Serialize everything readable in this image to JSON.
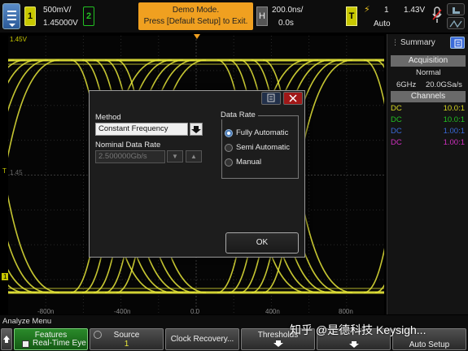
{
  "top": {
    "menu_icon": "hamburger-menu-icon",
    "ch1_label": "1",
    "ch1_scale": "500mV/",
    "ch1_offset": "1.45000V",
    "ch2_label": "2",
    "demo_line1": "Demo Mode.",
    "demo_line2": "Press [Default Setup] to Exit.",
    "h_label": "H",
    "timebase": "200.0ns/",
    "delay": "0.0s",
    "t_label": "T",
    "trigger_symbol": "⚡",
    "trigger_ch": "1",
    "trigger_level": "1.43V",
    "trigger_mode": "Auto"
  },
  "plot": {
    "level_top": "1.45V",
    "level_mid": "1.45",
    "trigger_marker": "T",
    "ground_marker": "1",
    "xticks": [
      "-800n",
      "-400n",
      "0.0",
      "400n",
      "800n"
    ],
    "trace_color": "#e8e83a"
  },
  "panel": {
    "tab": "Summary",
    "acquisition_title": "Acquisition",
    "acq_mode": "Normal",
    "bandwidth": "6GHz",
    "sample_rate": "20.0GSa/s",
    "channels_title": "Channels",
    "channels": [
      {
        "coupling": "DC",
        "ratio": "10.0:1",
        "color": "#d8d820"
      },
      {
        "coupling": "DC",
        "ratio": "10.0:1",
        "color": "#22c022"
      },
      {
        "coupling": "DC",
        "ratio": "1.00:1",
        "color": "#3a6ad8"
      },
      {
        "coupling": "DC",
        "ratio": "1.00:1",
        "color": "#d030c0"
      }
    ]
  },
  "dialog": {
    "method_label": "Method",
    "method_value": "Constant Frequency",
    "nominal_label": "Nominal Data Rate",
    "nominal_value": "2.500000Gb/s",
    "data_rate_title": "Data Rate",
    "options": [
      "Fully Automatic",
      "Semi Automatic",
      "Manual"
    ],
    "selected": 0,
    "ok_label": "OK"
  },
  "bottom": {
    "menu_title": "Analyze Menu",
    "features_label": "Features",
    "realtime_eye_label": "Real-Time Eye",
    "source_label": "Source",
    "source_value": "1",
    "clock_recovery_label": "Clock Recovery...",
    "thresholds_label": "Thresholds",
    "auto_setup_label": "Auto Setup"
  },
  "watermark": "知乎 @是德科技 Keysigh..."
}
